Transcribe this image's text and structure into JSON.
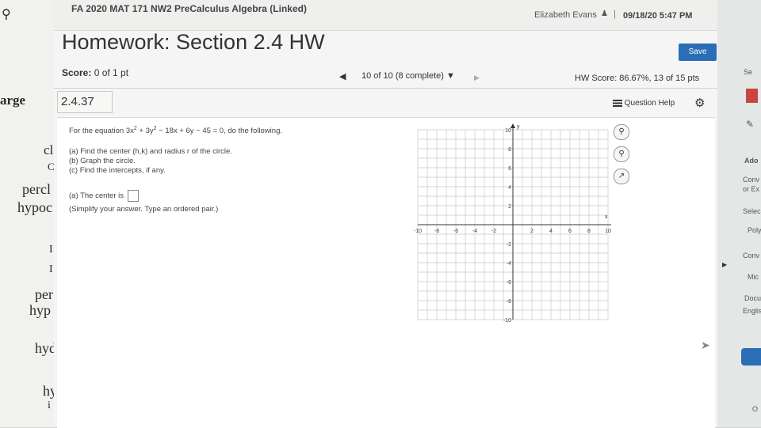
{
  "background_left": {
    "lines": [
      "arge",
      "cl",
      "C",
      "percl",
      "hypoc",
      "I",
      "I",
      "per",
      "hyp",
      "hyd",
      "hy",
      "i"
    ]
  },
  "background_right": {
    "lines": [
      "Se",
      "Ado",
      "Conv",
      "or Ex",
      "Selec",
      "Poly",
      "Conv",
      "Mic",
      "Docu",
      "Englis",
      "O"
    ]
  },
  "header": {
    "course_title": "FA 2020 MAT 171 NW2 PreCalculus Algebra (Linked)",
    "user_name": "Elizabeth Evans",
    "separator": "|",
    "datetime": "09/18/20 5:47 PM"
  },
  "homework": {
    "title": "Homework: Section 2.4 HW",
    "save_label": "Save",
    "score_label": "Score:",
    "score_value": "0 of 1 pt",
    "nav_prev": "◀",
    "nav_label": "10 of 10 (8 complete) ▼",
    "nav_next": "▶",
    "hw_score": "HW Score: 86.67%, 13 of 15 pts"
  },
  "question": {
    "number": "2.4.37",
    "help_label": "Question Help",
    "prompt_pre": "For the equation 3x",
    "sup1": "2",
    "prompt_mid": " + 3y",
    "sup2": "2",
    "prompt_post": " − 18x + 6y − 45 = 0, do the following.",
    "part_a": "(a) Find the center (h,k) and radius r of the circle.",
    "part_b": "(b) Graph the circle.",
    "part_c": "(c) Find the intercepts, if any.",
    "answer_label": "(a) The center is",
    "instruction": "(Simplify your answer. Type an ordered pair.)"
  },
  "graph": {
    "y_label": "y",
    "x_label": "x",
    "x_ticks": [
      "-10",
      "-8",
      "-6",
      "-4",
      "-2",
      "2",
      "4",
      "6",
      "8",
      "10"
    ],
    "y_ticks": [
      "10",
      "8",
      "6",
      "4",
      "2",
      "-2",
      "-4",
      "-6",
      "-8",
      "-10"
    ]
  },
  "tools": {
    "zoom_in": "zoom-in-icon",
    "zoom_out": "zoom-out-icon",
    "popout": "popout-icon"
  }
}
